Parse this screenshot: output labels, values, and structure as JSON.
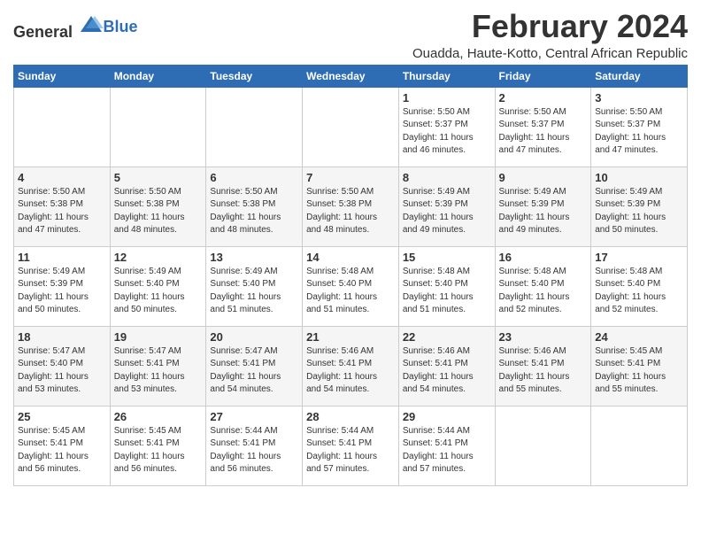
{
  "logo": {
    "general": "General",
    "blue": "Blue"
  },
  "title": {
    "month_year": "February 2024",
    "location": "Ouadda, Haute-Kotto, Central African Republic"
  },
  "days_of_week": [
    "Sunday",
    "Monday",
    "Tuesday",
    "Wednesday",
    "Thursday",
    "Friday",
    "Saturday"
  ],
  "weeks": [
    [
      {
        "day": "",
        "sunrise": "",
        "sunset": "",
        "daylight": ""
      },
      {
        "day": "",
        "sunrise": "",
        "sunset": "",
        "daylight": ""
      },
      {
        "day": "",
        "sunrise": "",
        "sunset": "",
        "daylight": ""
      },
      {
        "day": "",
        "sunrise": "",
        "sunset": "",
        "daylight": ""
      },
      {
        "day": "1",
        "sunrise": "5:50 AM",
        "sunset": "5:37 PM",
        "daylight": "11 hours and 46 minutes."
      },
      {
        "day": "2",
        "sunrise": "5:50 AM",
        "sunset": "5:37 PM",
        "daylight": "11 hours and 47 minutes."
      },
      {
        "day": "3",
        "sunrise": "5:50 AM",
        "sunset": "5:37 PM",
        "daylight": "11 hours and 47 minutes."
      }
    ],
    [
      {
        "day": "4",
        "sunrise": "5:50 AM",
        "sunset": "5:38 PM",
        "daylight": "11 hours and 47 minutes."
      },
      {
        "day": "5",
        "sunrise": "5:50 AM",
        "sunset": "5:38 PM",
        "daylight": "11 hours and 48 minutes."
      },
      {
        "day": "6",
        "sunrise": "5:50 AM",
        "sunset": "5:38 PM",
        "daylight": "11 hours and 48 minutes."
      },
      {
        "day": "7",
        "sunrise": "5:50 AM",
        "sunset": "5:38 PM",
        "daylight": "11 hours and 48 minutes."
      },
      {
        "day": "8",
        "sunrise": "5:49 AM",
        "sunset": "5:39 PM",
        "daylight": "11 hours and 49 minutes."
      },
      {
        "day": "9",
        "sunrise": "5:49 AM",
        "sunset": "5:39 PM",
        "daylight": "11 hours and 49 minutes."
      },
      {
        "day": "10",
        "sunrise": "5:49 AM",
        "sunset": "5:39 PM",
        "daylight": "11 hours and 50 minutes."
      }
    ],
    [
      {
        "day": "11",
        "sunrise": "5:49 AM",
        "sunset": "5:39 PM",
        "daylight": "11 hours and 50 minutes."
      },
      {
        "day": "12",
        "sunrise": "5:49 AM",
        "sunset": "5:40 PM",
        "daylight": "11 hours and 50 minutes."
      },
      {
        "day": "13",
        "sunrise": "5:49 AM",
        "sunset": "5:40 PM",
        "daylight": "11 hours and 51 minutes."
      },
      {
        "day": "14",
        "sunrise": "5:48 AM",
        "sunset": "5:40 PM",
        "daylight": "11 hours and 51 minutes."
      },
      {
        "day": "15",
        "sunrise": "5:48 AM",
        "sunset": "5:40 PM",
        "daylight": "11 hours and 51 minutes."
      },
      {
        "day": "16",
        "sunrise": "5:48 AM",
        "sunset": "5:40 PM",
        "daylight": "11 hours and 52 minutes."
      },
      {
        "day": "17",
        "sunrise": "5:48 AM",
        "sunset": "5:40 PM",
        "daylight": "11 hours and 52 minutes."
      }
    ],
    [
      {
        "day": "18",
        "sunrise": "5:47 AM",
        "sunset": "5:40 PM",
        "daylight": "11 hours and 53 minutes."
      },
      {
        "day": "19",
        "sunrise": "5:47 AM",
        "sunset": "5:41 PM",
        "daylight": "11 hours and 53 minutes."
      },
      {
        "day": "20",
        "sunrise": "5:47 AM",
        "sunset": "5:41 PM",
        "daylight": "11 hours and 54 minutes."
      },
      {
        "day": "21",
        "sunrise": "5:46 AM",
        "sunset": "5:41 PM",
        "daylight": "11 hours and 54 minutes."
      },
      {
        "day": "22",
        "sunrise": "5:46 AM",
        "sunset": "5:41 PM",
        "daylight": "11 hours and 54 minutes."
      },
      {
        "day": "23",
        "sunrise": "5:46 AM",
        "sunset": "5:41 PM",
        "daylight": "11 hours and 55 minutes."
      },
      {
        "day": "24",
        "sunrise": "5:45 AM",
        "sunset": "5:41 PM",
        "daylight": "11 hours and 55 minutes."
      }
    ],
    [
      {
        "day": "25",
        "sunrise": "5:45 AM",
        "sunset": "5:41 PM",
        "daylight": "11 hours and 56 minutes."
      },
      {
        "day": "26",
        "sunrise": "5:45 AM",
        "sunset": "5:41 PM",
        "daylight": "11 hours and 56 minutes."
      },
      {
        "day": "27",
        "sunrise": "5:44 AM",
        "sunset": "5:41 PM",
        "daylight": "11 hours and 56 minutes."
      },
      {
        "day": "28",
        "sunrise": "5:44 AM",
        "sunset": "5:41 PM",
        "daylight": "11 hours and 57 minutes."
      },
      {
        "day": "29",
        "sunrise": "5:44 AM",
        "sunset": "5:41 PM",
        "daylight": "11 hours and 57 minutes."
      },
      {
        "day": "",
        "sunrise": "",
        "sunset": "",
        "daylight": ""
      },
      {
        "day": "",
        "sunrise": "",
        "sunset": "",
        "daylight": ""
      }
    ]
  ]
}
